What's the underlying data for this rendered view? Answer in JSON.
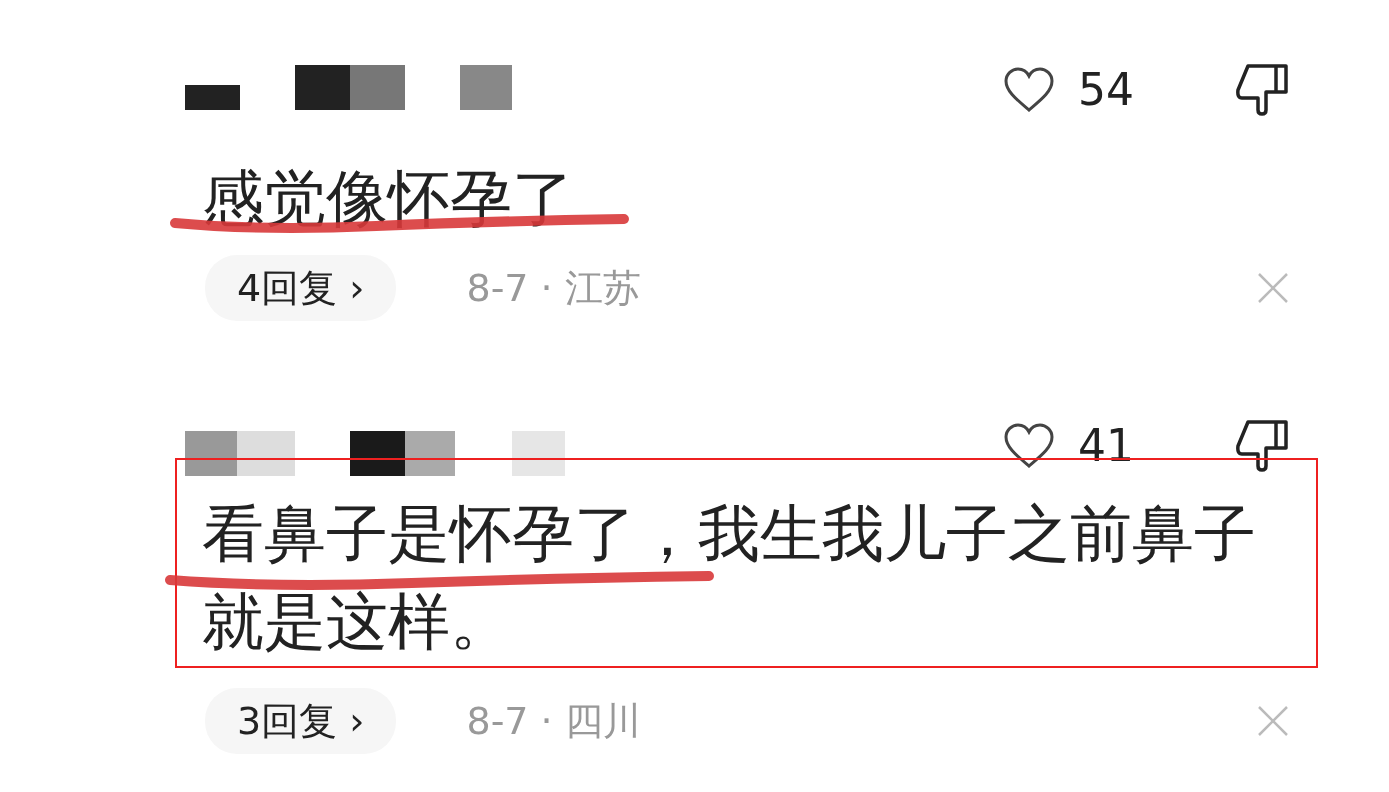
{
  "comments": [
    {
      "likes": "54",
      "text": "感觉像怀孕了",
      "underlined": true,
      "boxed": false,
      "replies": "4回复 ›",
      "date_location": "8-7 · 江苏"
    },
    {
      "likes": "41",
      "text": "看鼻子是怀孕了，我生我儿子之前鼻子就是这样。",
      "underlined": true,
      "boxed": true,
      "replies": "3回复 ›",
      "date_location": "8-7 · 四川"
    }
  ]
}
